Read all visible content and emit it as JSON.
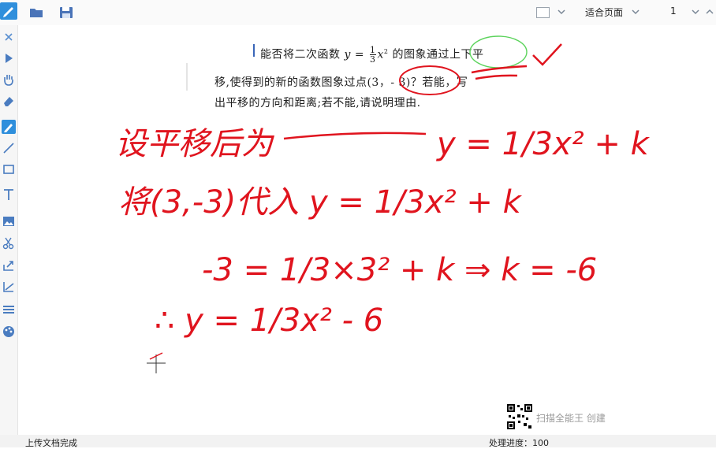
{
  "toolbar": {
    "icons": [
      "pen-edit-icon",
      "folder-open-icon",
      "save-disk-icon"
    ],
    "view_mode": "适合页面",
    "page_number": "1"
  },
  "tools": [
    "close-icon",
    "pointer-icon",
    "hand-pan-icon",
    "eraser-icon",
    "pen-icon",
    "line-icon",
    "rectangle-icon",
    "text-icon",
    "image-icon",
    "scissors-icon",
    "export-icon",
    "chart-icon",
    "lines-icon",
    "palette-icon"
  ],
  "document": {
    "problem_line1_a": "能否将二次函数",
    "problem_line1_var": "y =",
    "problem_frac_num": "1",
    "problem_frac_den": "3",
    "problem_line1_x": "x",
    "problem_line1_sup": "2",
    "problem_line1_b": "的图象通过上下平",
    "problem_line2": "移,使得到的新的函数图象过点(3，- 3)？若能，写",
    "problem_line3": "出平移的方向和距离;若不能,请说明理由.",
    "watermark": "扫描全能王  创建"
  },
  "handwriting": {
    "line1_left": "设平移后为",
    "line1_right": "y = 1/3x² + k",
    "line2": "将(3,-3)代入 y = 1/3x² + k",
    "line3": "-3 = 1/3×3² + k  ⇒ k = -6",
    "line4": "∴ y = 1/3x² - 6"
  },
  "status": {
    "left": "上传文档完成",
    "right": "处理进度：100"
  },
  "colors": {
    "ink_red": "#e0141e",
    "ink_green": "#5bd35b",
    "active_tool": "#2f8fdc"
  }
}
